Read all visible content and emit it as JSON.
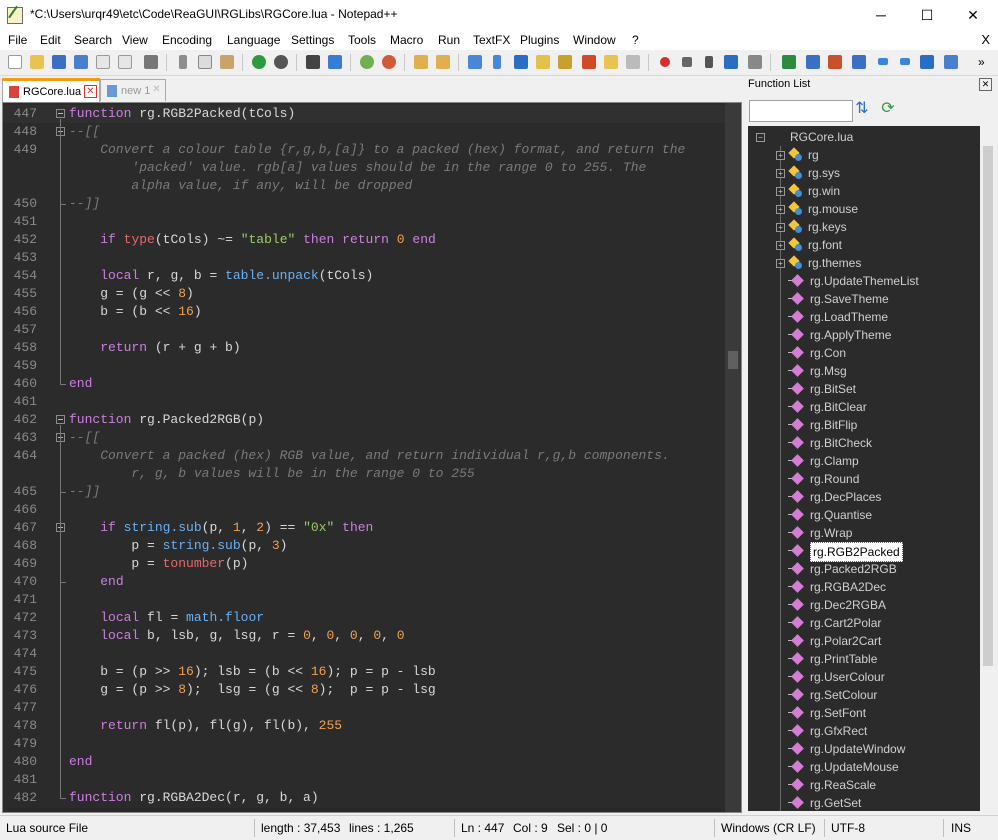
{
  "window": {
    "title": "*C:\\Users\\urqr49\\etc\\Code\\ReaGUI\\RGLibs\\RGCore.lua - Notepad++",
    "minimize": "─",
    "maximize": "☐",
    "close": "✕"
  },
  "menu": {
    "items": [
      "File",
      "Edit",
      "Search",
      "View",
      "Encoding",
      "Language",
      "Settings",
      "Tools",
      "Macro",
      "Run",
      "TextFX",
      "Plugins",
      "Window",
      "?"
    ],
    "close_doc": "X"
  },
  "tabs": [
    {
      "label": "RGCore.lua",
      "close": "✕"
    },
    {
      "label": "new 1",
      "close": "✕"
    }
  ],
  "editor": {
    "lines": [
      {
        "n": "447",
        "html": "<span class=\"kw\">function</span> rg.RGB2Packed(tCols)"
      },
      {
        "n": "448",
        "html": "<span class=\"cm\">--[[</span>"
      },
      {
        "n": "449",
        "html": "<span class=\"cm\">    Convert a colour table {r,g,b,[a]} to a packed (hex) format, and return the</span>"
      },
      {
        "n": "",
        "html": "<span class=\"cm\">        'packed' value. rgb[a] values should be in the range 0 to 255. The</span>"
      },
      {
        "n": "",
        "html": "<span class=\"cm\">        alpha value, if any, will be dropped</span>"
      },
      {
        "n": "450",
        "html": "<span class=\"cm\">--]]</span>"
      },
      {
        "n": "451",
        "html": ""
      },
      {
        "n": "452",
        "html": "    <span class=\"kw\">if</span> <span class=\"bi\">type</span>(tCols) ~= <span class=\"str\">\"table\"</span> <span class=\"kw\">then</span> <span class=\"kw\">return</span> <span class=\"num\">0</span> <span class=\"kw\">end</span>"
      },
      {
        "n": "453",
        "html": ""
      },
      {
        "n": "454",
        "html": "    <span class=\"kw\">local</span> r, g, b = <span class=\"fn\">table.unpack</span>(tCols)"
      },
      {
        "n": "455",
        "html": "    g = (g &lt;&lt; <span class=\"num\">8</span>)"
      },
      {
        "n": "456",
        "html": "    b = (b &lt;&lt; <span class=\"num\">16</span>)"
      },
      {
        "n": "457",
        "html": ""
      },
      {
        "n": "458",
        "html": "    <span class=\"kw\">return</span> (r + g + b)"
      },
      {
        "n": "459",
        "html": ""
      },
      {
        "n": "460",
        "html": "<span class=\"kw\">end</span>"
      },
      {
        "n": "461",
        "html": ""
      },
      {
        "n": "462",
        "html": "<span class=\"kw\">function</span> rg.Packed2RGB(p)"
      },
      {
        "n": "463",
        "html": "<span class=\"cm\">--[[</span>"
      },
      {
        "n": "464",
        "html": "<span class=\"cm\">    Convert a packed (hex) RGB value, and return individual r,g,b components.</span>"
      },
      {
        "n": "",
        "html": "<span class=\"cm\">        r, g, b values will be in the range 0 to 255</span>"
      },
      {
        "n": "465",
        "html": "<span class=\"cm\">--]]</span>"
      },
      {
        "n": "466",
        "html": ""
      },
      {
        "n": "467",
        "html": "    <span class=\"kw\">if</span> <span class=\"fn\">string.sub</span>(p, <span class=\"num\">1</span>, <span class=\"num\">2</span>) == <span class=\"str\">\"0x\"</span> <span class=\"kw\">then</span>"
      },
      {
        "n": "468",
        "html": "        p = <span class=\"fn\">string.sub</span>(p, <span class=\"num\">3</span>)"
      },
      {
        "n": "469",
        "html": "        p = <span class=\"bi\">tonumber</span>(p)"
      },
      {
        "n": "470",
        "html": "    <span class=\"kw\">end</span>"
      },
      {
        "n": "471",
        "html": ""
      },
      {
        "n": "472",
        "html": "    <span class=\"kw\">local</span> fl = <span class=\"fn\">math.floor</span>"
      },
      {
        "n": "473",
        "html": "    <span class=\"kw\">local</span> b, lsb, g, lsg, r = <span class=\"num\">0</span>, <span class=\"num\">0</span>, <span class=\"num\">0</span>, <span class=\"num\">0</span>, <span class=\"num\">0</span>"
      },
      {
        "n": "474",
        "html": ""
      },
      {
        "n": "475",
        "html": "    b = (p &gt;&gt; <span class=\"num\">16</span>); lsb = (b &lt;&lt; <span class=\"num\">16</span>); p = p - lsb"
      },
      {
        "n": "476",
        "html": "    g = (p &gt;&gt; <span class=\"num\">8</span>);  lsg = (g &lt;&lt; <span class=\"num\">8</span>);  p = p - lsg"
      },
      {
        "n": "477",
        "html": ""
      },
      {
        "n": "478",
        "html": "    <span class=\"kw\">return</span> fl(p), fl(g), fl(b), <span class=\"num\">255</span>"
      },
      {
        "n": "479",
        "html": ""
      },
      {
        "n": "480",
        "html": "<span class=\"kw\">end</span>"
      },
      {
        "n": "481",
        "html": ""
      },
      {
        "n": "482",
        "html": "<span class=\"kw\">function</span> rg.RGBA2Dec(r, g, b, a)"
      }
    ]
  },
  "function_list": {
    "title": "Function List",
    "close": "✕",
    "search_value": "",
    "root": "RGCore.lua",
    "groups": [
      "rg",
      "rg.sys",
      "rg.win",
      "rg.mouse",
      "rg.keys",
      "rg.font",
      "rg.themes"
    ],
    "functions": [
      "rg.UpdateThemeList",
      "rg.SaveTheme",
      "rg.LoadTheme",
      "rg.ApplyTheme",
      "rg.Con",
      "rg.Msg",
      "rg.BitSet",
      "rg.BitClear",
      "rg.BitFlip",
      "rg.BitCheck",
      "rg.Clamp",
      "rg.Round",
      "rg.DecPlaces",
      "rg.Quantise",
      "rg.Wrap",
      "rg.RGB2Packed",
      "rg.Packed2RGB",
      "rg.RGBA2Dec",
      "rg.Dec2RGBA",
      "rg.Cart2Polar",
      "rg.Polar2Cart",
      "rg.PrintTable",
      "rg.UserColour",
      "rg.SetColour",
      "rg.SetFont",
      "rg.GfxRect",
      "rg.UpdateWindow",
      "rg.UpdateMouse",
      "rg.ReaScale",
      "rg.GetSet"
    ],
    "selected": "rg.RGB2Packed"
  },
  "status": {
    "language": "Lua source File",
    "length": "length : 37,453",
    "lines": "lines : 1,265",
    "ln": "Ln : 447",
    "col": "Col : 9",
    "sel": "Sel : 0 | 0",
    "eol": "Windows (CR LF)",
    "encoding": "UTF-8",
    "mode": "INS"
  },
  "colors": {
    "editor_bg": "#2b2b2b",
    "keyword": "#cc7fe0",
    "string": "#9ccc65",
    "number": "#f0a050",
    "comment": "#7a7a7a",
    "tab_accent": "#f39c12"
  }
}
